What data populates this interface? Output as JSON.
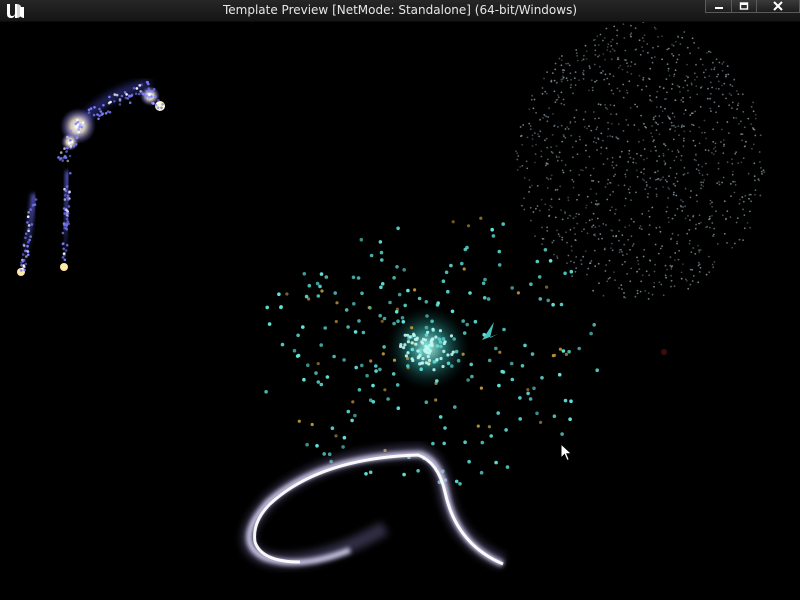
{
  "window": {
    "title": "Template Preview [NetMode: Standalone]  (64-bit/Windows)",
    "logo_icon": "unreal-engine-logo-icon",
    "controls": [
      "minimize-icon",
      "maximize-icon",
      "close-icon"
    ]
  },
  "viewport": {
    "background_color": "#000000",
    "effects": [
      "firework-trails",
      "particle-sphere-cloud",
      "radial-particle-burst",
      "ribbon-trail"
    ]
  },
  "colors": {
    "burst_cyan": "#5fe6dc",
    "burst_gold": "#b8953a",
    "trail_blue": "#4a4fd8",
    "cloud_gray": "#8fa3ad",
    "ribbon_white": "#ffffff",
    "ribbon_violet": "#8e86c8"
  }
}
